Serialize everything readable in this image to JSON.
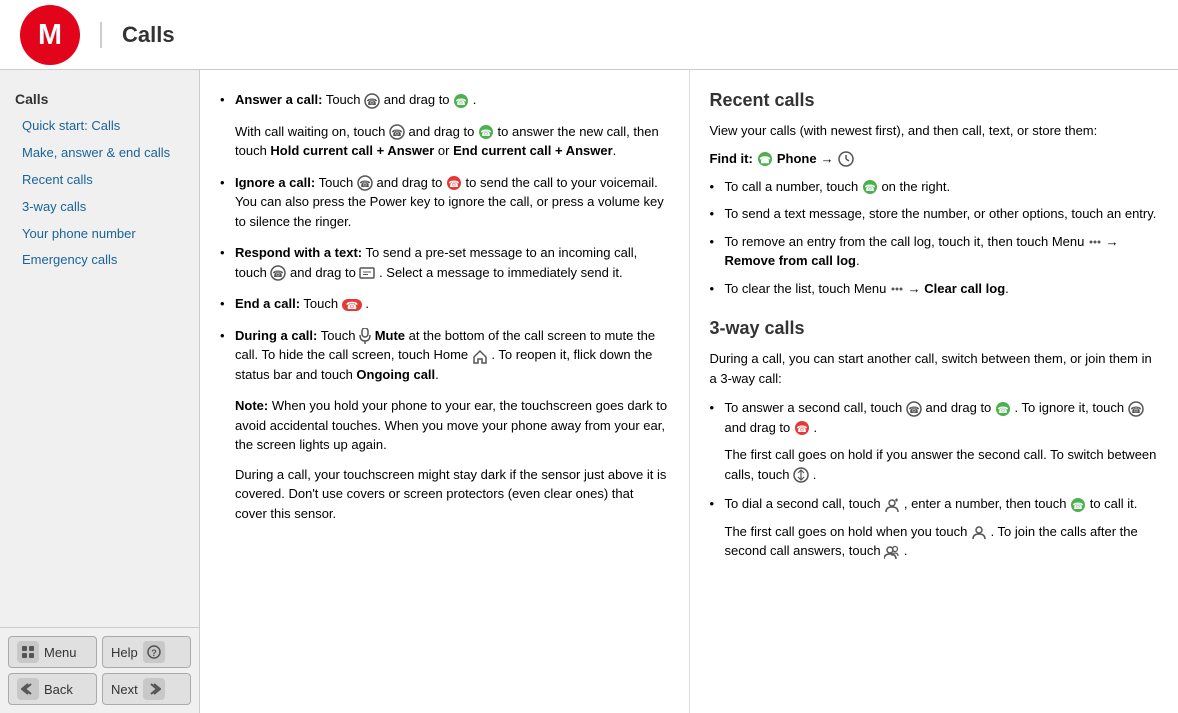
{
  "header": {
    "title": "Calls"
  },
  "sidebar": {
    "items": [
      {
        "label": "Calls",
        "level": "top"
      },
      {
        "label": "Quick start: Calls",
        "level": "indented"
      },
      {
        "label": "Make, answer & end calls",
        "level": "indented"
      },
      {
        "label": "Recent calls",
        "level": "indented"
      },
      {
        "label": "3-way calls",
        "level": "indented"
      },
      {
        "label": "Your phone number",
        "level": "indented"
      },
      {
        "label": "Emergency calls",
        "level": "indented"
      }
    ],
    "bottom_nav": {
      "menu_label": "Menu",
      "help_label": "Help",
      "back_label": "Back",
      "next_label": "Next"
    }
  },
  "left_content": {
    "bullets": [
      {
        "term": "Answer a call:",
        "text": " Touch  and drag to  ."
      },
      {
        "term": "",
        "text": "With call waiting on, touch  and drag to  to answer the new call, then touch Hold current call + Answer or End current call + Answer."
      },
      {
        "term": "Ignore a call:",
        "text": " Touch  and drag to  to send the call to your voicemail. You can also press the Power key to ignore the call, or press a volume key to silence the ringer."
      },
      {
        "term": "Respond with a text:",
        "text": " To send a pre-set message to an incoming call, touch  and drag to  . Select a message to immediately send it."
      },
      {
        "term": "End a call:",
        "text": " Touch  ."
      },
      {
        "term": "During a call:",
        "text": " Touch  Mute at the bottom of the call screen to mute the call. To hide the call screen, touch Home  . To reopen it, flick down the status bar and touch Ongoing call."
      }
    ],
    "note": {
      "label": "Note:",
      "text": " When you hold your phone to your ear, the touchscreen goes dark to avoid accidental touches. When you move your phone away from your ear, the screen lights up again."
    },
    "note2": "During a call, your touchscreen might stay dark if the sensor just above it is covered. Don't use covers or screen protectors (even clear ones) that cover this sensor."
  },
  "right_content": {
    "recent_calls_title": "Recent calls",
    "recent_calls_intro": "View your calls (with newest first), and then call, text, or store them:",
    "find_it_label": "Find it:",
    "find_it_path": " Phone →  ",
    "recent_bullets": [
      "To call a number, touch  on the right.",
      "To send a text message, store the number, or other options, touch an entry.",
      "To remove an entry from the call log, touch it, then touch Menu  → Remove from call log.",
      "To clear the list, touch Menu  → Clear call log."
    ],
    "three_way_title": "3-way calls",
    "three_way_intro": "During a call, you can start another call, switch between them, or join them in a 3-way call:",
    "three_way_bullets": [
      "To answer a second call, touch  and drag to  . To ignore it, touch  and drag to  .",
      "The first call goes on hold if you answer the second call. To switch between calls, touch  .",
      "To dial a second call, touch  , enter a number, then touch  to call it.",
      "The first call goes on hold when you touch  . To join the calls after the second call answers, touch  ."
    ]
  }
}
